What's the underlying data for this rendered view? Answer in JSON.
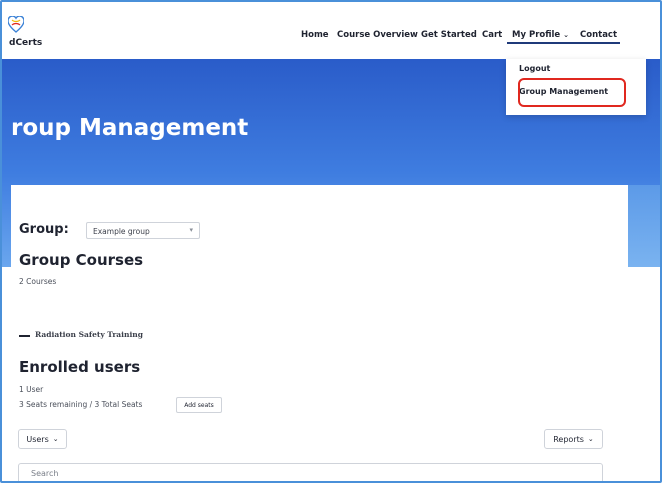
{
  "brand": {
    "logo_text": "dCerts"
  },
  "nav": {
    "home": "Home",
    "course_overview": "Course Overview",
    "get_started": "Get Started",
    "cart": "Cart",
    "my_profile": "My Profile",
    "contact": "Contact"
  },
  "profile_menu": {
    "logout": "Logout",
    "group_management": "Group Management"
  },
  "hero": {
    "title": "roup Management"
  },
  "group": {
    "label": "Group:",
    "selected": "Example group"
  },
  "group_courses": {
    "heading": "Group Courses",
    "count": "2 Courses",
    "items": [
      "Radiation Safety Training"
    ]
  },
  "enrolled": {
    "heading": "Enrolled users",
    "user_count": "1 User",
    "seats": "3 Seats remaining / 3 Total Seats",
    "add_seats": "Add seats"
  },
  "toolbar": {
    "users": "Users",
    "reports": "Reports"
  },
  "search": {
    "placeholder": "Search"
  },
  "colors": {
    "accent": "#1f3a7a",
    "hero_top": "#2a5cc9",
    "hero_bottom": "#6aa6ee",
    "highlight": "#e0281f"
  },
  "icons": [
    "heart-logo-icon",
    "chevron-down-icon",
    "select-caret-icon",
    "dash-icon"
  ]
}
